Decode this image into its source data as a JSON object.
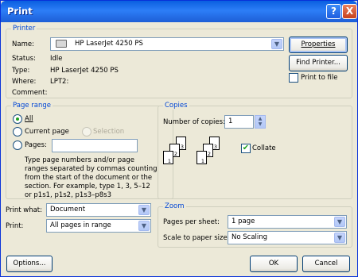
{
  "window": {
    "title": "Print",
    "help_glyph": "?",
    "close_glyph": "X"
  },
  "printer": {
    "legend": "Printer",
    "name_label": "Name:",
    "name_value": "HP LaserJet 4250 PS",
    "properties_label": "Properties",
    "find_printer_label": "Find Printer...",
    "print_to_file_label": "Print to file",
    "print_to_file_checked": false,
    "status_label": "Status:",
    "status_value": "Idle",
    "type_label": "Type:",
    "type_value": "HP LaserJet 4250 PS",
    "where_label": "Where:",
    "where_value": "LPT2:",
    "comment_label": "Comment:",
    "comment_value": ""
  },
  "page_range": {
    "legend": "Page range",
    "all_label": "All",
    "current_page_label": "Current page",
    "selection_label": "Selection",
    "pages_label": "Pages:",
    "pages_value": "",
    "selected": "all",
    "help_line1": "Type page numbers and/or page",
    "help_line2": "ranges separated by commas counting",
    "help_line3": "from the start of the document or the",
    "help_line4": "section. For example, type 1, 3, 5–12",
    "help_line5": "or p1s1, p1s2, p1s3–p8s3"
  },
  "copies": {
    "legend": "Copies",
    "number_label": "Number of copies:",
    "number_value": "1",
    "collate_label": "Collate",
    "collate_checked": true,
    "page_nums": [
      "3",
      "2",
      "1",
      "3",
      "2",
      "1"
    ]
  },
  "print_what": {
    "label": "Print what:",
    "value": "Document"
  },
  "print": {
    "label": "Print:",
    "value": "All pages in range"
  },
  "zoom": {
    "legend": "Zoom",
    "pages_per_sheet_label": "Pages per sheet:",
    "pages_per_sheet_value": "1 page",
    "scale_label": "Scale to paper size:",
    "scale_value": "No Scaling"
  },
  "footer": {
    "options_label": "Options...",
    "ok_label": "OK",
    "cancel_label": "Cancel"
  }
}
